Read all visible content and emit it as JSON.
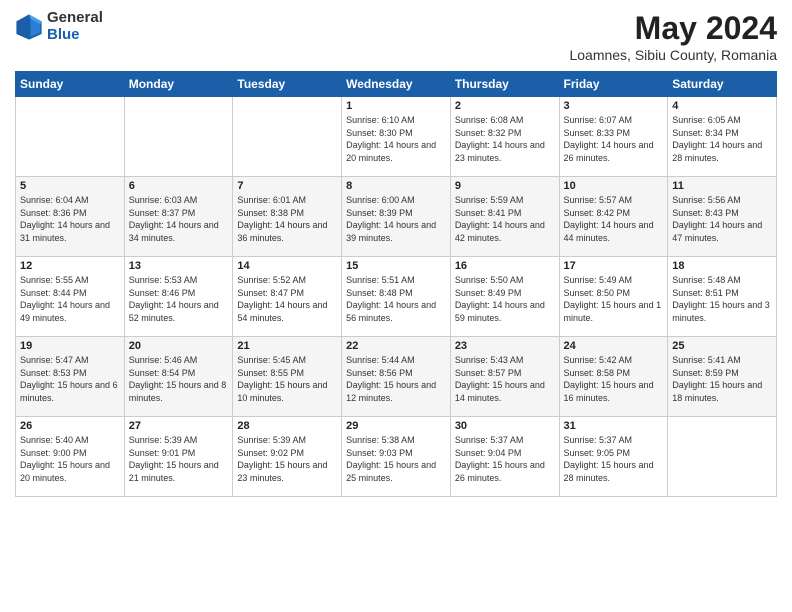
{
  "header": {
    "logo_general": "General",
    "logo_blue": "Blue",
    "title": "May 2024",
    "location": "Loamnes, Sibiu County, Romania"
  },
  "weekdays": [
    "Sunday",
    "Monday",
    "Tuesday",
    "Wednesday",
    "Thursday",
    "Friday",
    "Saturday"
  ],
  "weeks": [
    [
      {
        "day": "",
        "detail": ""
      },
      {
        "day": "",
        "detail": ""
      },
      {
        "day": "",
        "detail": ""
      },
      {
        "day": "1",
        "detail": "Sunrise: 6:10 AM\nSunset: 8:30 PM\nDaylight: 14 hours\nand 20 minutes."
      },
      {
        "day": "2",
        "detail": "Sunrise: 6:08 AM\nSunset: 8:32 PM\nDaylight: 14 hours\nand 23 minutes."
      },
      {
        "day": "3",
        "detail": "Sunrise: 6:07 AM\nSunset: 8:33 PM\nDaylight: 14 hours\nand 26 minutes."
      },
      {
        "day": "4",
        "detail": "Sunrise: 6:05 AM\nSunset: 8:34 PM\nDaylight: 14 hours\nand 28 minutes."
      }
    ],
    [
      {
        "day": "5",
        "detail": "Sunrise: 6:04 AM\nSunset: 8:36 PM\nDaylight: 14 hours\nand 31 minutes."
      },
      {
        "day": "6",
        "detail": "Sunrise: 6:03 AM\nSunset: 8:37 PM\nDaylight: 14 hours\nand 34 minutes."
      },
      {
        "day": "7",
        "detail": "Sunrise: 6:01 AM\nSunset: 8:38 PM\nDaylight: 14 hours\nand 36 minutes."
      },
      {
        "day": "8",
        "detail": "Sunrise: 6:00 AM\nSunset: 8:39 PM\nDaylight: 14 hours\nand 39 minutes."
      },
      {
        "day": "9",
        "detail": "Sunrise: 5:59 AM\nSunset: 8:41 PM\nDaylight: 14 hours\nand 42 minutes."
      },
      {
        "day": "10",
        "detail": "Sunrise: 5:57 AM\nSunset: 8:42 PM\nDaylight: 14 hours\nand 44 minutes."
      },
      {
        "day": "11",
        "detail": "Sunrise: 5:56 AM\nSunset: 8:43 PM\nDaylight: 14 hours\nand 47 minutes."
      }
    ],
    [
      {
        "day": "12",
        "detail": "Sunrise: 5:55 AM\nSunset: 8:44 PM\nDaylight: 14 hours\nand 49 minutes."
      },
      {
        "day": "13",
        "detail": "Sunrise: 5:53 AM\nSunset: 8:46 PM\nDaylight: 14 hours\nand 52 minutes."
      },
      {
        "day": "14",
        "detail": "Sunrise: 5:52 AM\nSunset: 8:47 PM\nDaylight: 14 hours\nand 54 minutes."
      },
      {
        "day": "15",
        "detail": "Sunrise: 5:51 AM\nSunset: 8:48 PM\nDaylight: 14 hours\nand 56 minutes."
      },
      {
        "day": "16",
        "detail": "Sunrise: 5:50 AM\nSunset: 8:49 PM\nDaylight: 14 hours\nand 59 minutes."
      },
      {
        "day": "17",
        "detail": "Sunrise: 5:49 AM\nSunset: 8:50 PM\nDaylight: 15 hours\nand 1 minute."
      },
      {
        "day": "18",
        "detail": "Sunrise: 5:48 AM\nSunset: 8:51 PM\nDaylight: 15 hours\nand 3 minutes."
      }
    ],
    [
      {
        "day": "19",
        "detail": "Sunrise: 5:47 AM\nSunset: 8:53 PM\nDaylight: 15 hours\nand 6 minutes."
      },
      {
        "day": "20",
        "detail": "Sunrise: 5:46 AM\nSunset: 8:54 PM\nDaylight: 15 hours\nand 8 minutes."
      },
      {
        "day": "21",
        "detail": "Sunrise: 5:45 AM\nSunset: 8:55 PM\nDaylight: 15 hours\nand 10 minutes."
      },
      {
        "day": "22",
        "detail": "Sunrise: 5:44 AM\nSunset: 8:56 PM\nDaylight: 15 hours\nand 12 minutes."
      },
      {
        "day": "23",
        "detail": "Sunrise: 5:43 AM\nSunset: 8:57 PM\nDaylight: 15 hours\nand 14 minutes."
      },
      {
        "day": "24",
        "detail": "Sunrise: 5:42 AM\nSunset: 8:58 PM\nDaylight: 15 hours\nand 16 minutes."
      },
      {
        "day": "25",
        "detail": "Sunrise: 5:41 AM\nSunset: 8:59 PM\nDaylight: 15 hours\nand 18 minutes."
      }
    ],
    [
      {
        "day": "26",
        "detail": "Sunrise: 5:40 AM\nSunset: 9:00 PM\nDaylight: 15 hours\nand 20 minutes."
      },
      {
        "day": "27",
        "detail": "Sunrise: 5:39 AM\nSunset: 9:01 PM\nDaylight: 15 hours\nand 21 minutes."
      },
      {
        "day": "28",
        "detail": "Sunrise: 5:39 AM\nSunset: 9:02 PM\nDaylight: 15 hours\nand 23 minutes."
      },
      {
        "day": "29",
        "detail": "Sunrise: 5:38 AM\nSunset: 9:03 PM\nDaylight: 15 hours\nand 25 minutes."
      },
      {
        "day": "30",
        "detail": "Sunrise: 5:37 AM\nSunset: 9:04 PM\nDaylight: 15 hours\nand 26 minutes."
      },
      {
        "day": "31",
        "detail": "Sunrise: 5:37 AM\nSunset: 9:05 PM\nDaylight: 15 hours\nand 28 minutes."
      },
      {
        "day": "",
        "detail": ""
      }
    ]
  ]
}
